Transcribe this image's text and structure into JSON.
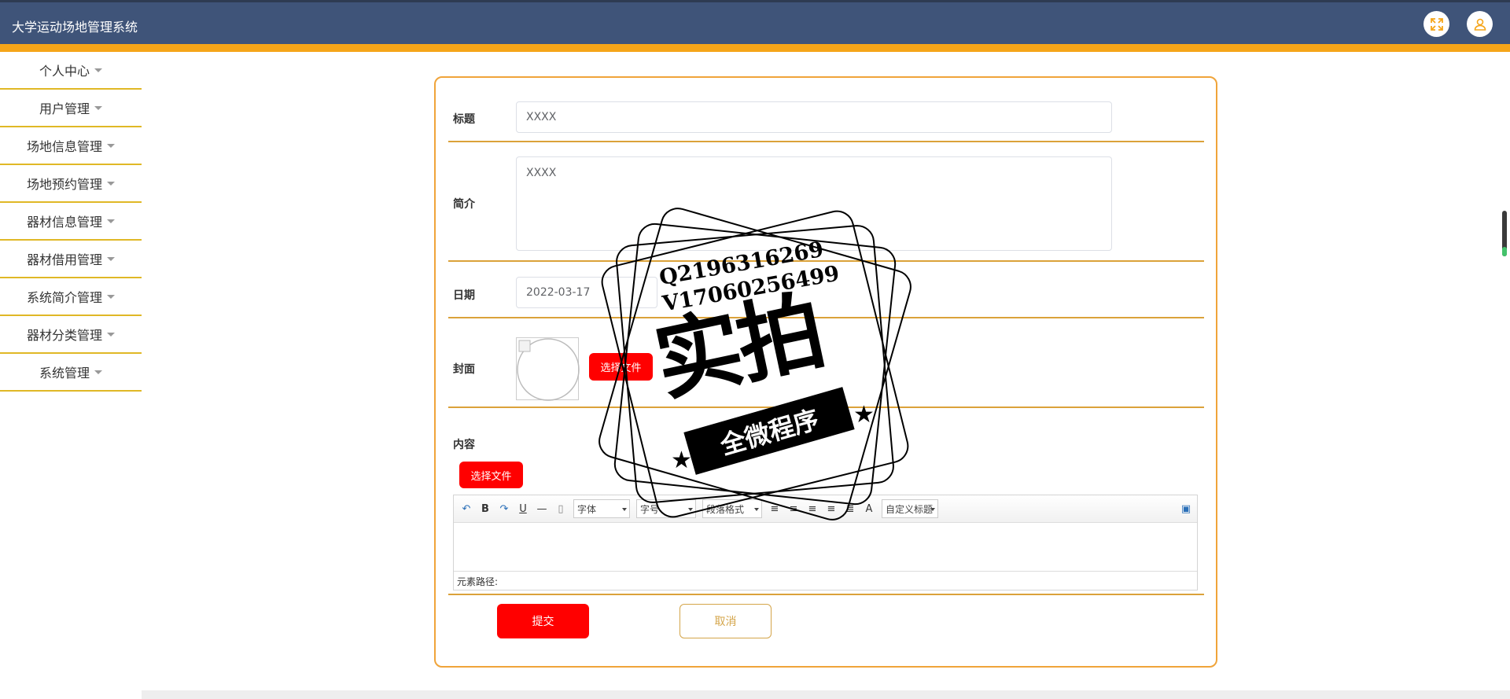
{
  "header": {
    "app_title": "大学运动场地管理系统",
    "fullscreen_icon": "fullscreen-icon",
    "user_icon": "user-icon"
  },
  "sidebar": {
    "items": [
      {
        "label": "个人中心"
      },
      {
        "label": "用户管理"
      },
      {
        "label": "场地信息管理"
      },
      {
        "label": "场地预约管理"
      },
      {
        "label": "器材信息管理"
      },
      {
        "label": "器材借用管理"
      },
      {
        "label": "系统简介管理"
      },
      {
        "label": "器材分类管理"
      },
      {
        "label": "系统管理"
      }
    ]
  },
  "form": {
    "title_label": "标题",
    "title_value": "XXXX",
    "intro_label": "简介",
    "intro_value": "XXXX",
    "date_label": "日期",
    "date_value": "2022-03-17",
    "cover_label": "封面",
    "cover_upload_label": "选择文件",
    "content_label": "内容",
    "content_upload_label": "选择文件",
    "editor": {
      "font_select": "字体",
      "size_select": "字号",
      "para_select": "段落格式",
      "custom_title_select": "自定义标题",
      "element_path": "元素路径:"
    },
    "submit_label": "提交",
    "cancel_label": "取消"
  },
  "watermark": {
    "line1": "Q2196316269",
    "line2": "V17060256499",
    "big_text": "实拍",
    "ribbon_text": "全微程序"
  },
  "colors": {
    "header_bg": "#3f5479",
    "accent_stripe": "#f5a519",
    "card_border": "#f0a43a",
    "primary_red": "#ff0000"
  }
}
